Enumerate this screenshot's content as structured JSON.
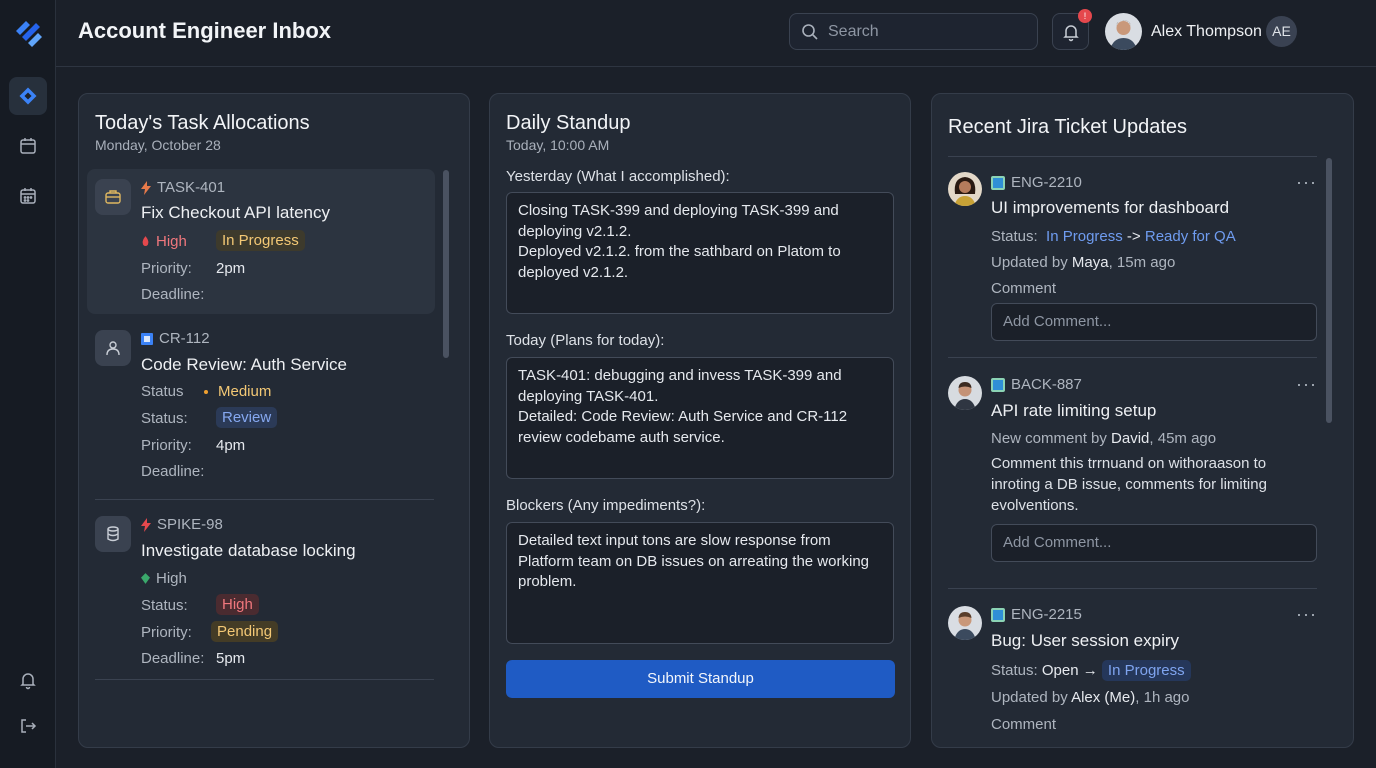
{
  "header": {
    "title": "Account Engineer Inbox",
    "search_placeholder": "Search",
    "notification_count": "!",
    "user_name": "Alex Thompson",
    "user_initials": "AE"
  },
  "tasks_panel": {
    "title": "Today's Task Allocations",
    "date": "Monday, October 28",
    "tasks": [
      {
        "id": "TASK-401",
        "title": "Fix Checkout API latency",
        "priority_label": "High",
        "status": "In Progress",
        "priority_row_label": "Priority:",
        "priority_row_value": "2pm",
        "deadline_label": "Deadline:",
        "deadline_value": ""
      },
      {
        "id": "CR-112",
        "title": "Code Review: Auth Service",
        "status_row_label": "Status",
        "severity": "Medium",
        "status_label": "Status:",
        "status": "Review",
        "priority_label": "Priority:",
        "priority_value": "4pm",
        "deadline_label": "Deadline:",
        "deadline_value": ""
      },
      {
        "id": "SPIKE-98",
        "title": "Investigate database locking",
        "severity": "High",
        "status_label": "Status:",
        "status": "High",
        "priority_label": "Priority:",
        "priority_value": "Pending",
        "deadline_label": "Deadline:",
        "deadline_value": "5pm"
      }
    ]
  },
  "standup": {
    "title": "Daily Standup",
    "time": "Today, 10:00 AM",
    "yesterday_label": "Yesterday (What I accomplished):",
    "yesterday_text": "Closing TASK-399 and deploying TASK-399 and deploying v2.1.2.\nDeployed v2.1.2. from the sathbard on Platom to deployed v2.1.2.",
    "today_label": "Today (Plans for today):",
    "today_text": "TASK-401: debugging and invess TASK-399 and deploying TASK-401.\nDetailed: Code Review: Auth Service and CR-112 review codebame auth service.",
    "blockers_label": "Blockers (Any impediments?):",
    "blockers_text": "Detailed text input tons are slow response from Platform team on DB issues on arreating the working problem.",
    "submit_label": "Submit Standup"
  },
  "jira": {
    "title": "Recent Jira Ticket Updates",
    "more_label": "···",
    "items": [
      {
        "key": "ENG-2210",
        "title": "UI improvements for dashboard",
        "status_prefix": "Status:",
        "status_from": "In Progress",
        "status_to": "Ready for QA",
        "updated_prefix": "Updated by",
        "updated_by": "Maya",
        "updated_when": ", 15m ago",
        "comment_label": "Comment",
        "input_placeholder": "Add Comment..."
      },
      {
        "key": "BACK-887",
        "title": "API rate limiting setup",
        "comment_meta_prefix": "New comment by",
        "comment_author": "David",
        "comment_when": ", 45m ago",
        "comment_text": "Comment this trrnuand on withoraason to inroting a DB issue, comments for limiting evolventions.",
        "input_placeholder": "Add Comment..."
      },
      {
        "key": "ENG-2215",
        "title": "Bug: User session expiry",
        "status_prefix": "Status:",
        "status_from": "Open",
        "status_to": "In Progress",
        "updated_prefix": "Updated by",
        "updated_by": "Alex (Me)",
        "updated_when": ", 1h ago",
        "comment_label": "Comment"
      }
    ]
  },
  "colors": {
    "accent": "#1f5bc4",
    "background": "#1b2029",
    "panel": "#232a35",
    "high": "#f0777d",
    "pending": "#f3c875",
    "review": "#86a8f0"
  },
  "icons": [
    "logo-icon",
    "inbox-icon",
    "calendar-icon",
    "calendar-grid-icon",
    "bell-icon",
    "logout-icon",
    "search-icon",
    "briefcase-icon",
    "user-icon",
    "database-icon",
    "bolt-icon",
    "flame-icon",
    "square-icon",
    "dot-icon",
    "shield-icon",
    "ticket-icon",
    "more-icon"
  ]
}
